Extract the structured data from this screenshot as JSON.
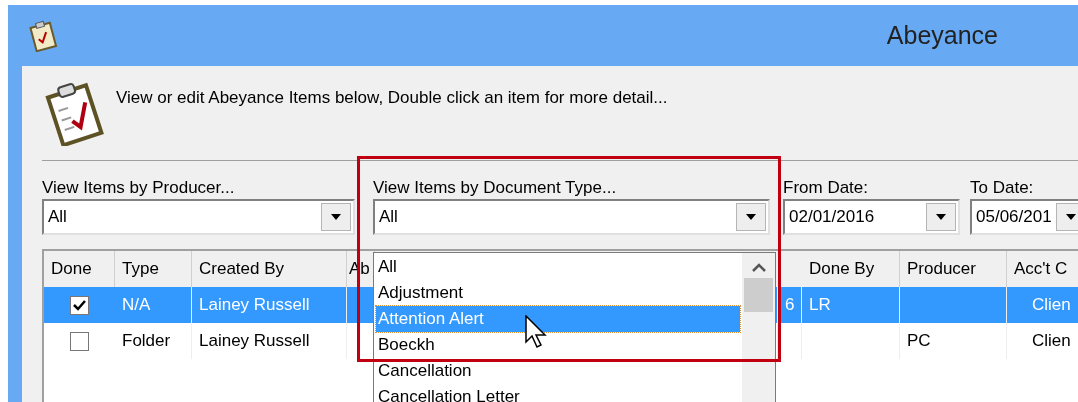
{
  "window": {
    "title": "Abeyance"
  },
  "header": {
    "text": "View or edit Abeyance Items below,  Double click an item for more detail..."
  },
  "filters": [
    {
      "label": "View  Items by Producer...",
      "value": "All"
    },
    {
      "label": "View Items by Document Type...",
      "value": "All"
    },
    {
      "label": "From Date:",
      "value": "02/01/2016"
    },
    {
      "label": "To Date:",
      "value": "05/06/201"
    }
  ],
  "dropdown": {
    "items": [
      {
        "label": "All",
        "selected": false
      },
      {
        "label": "Adjustment",
        "selected": false
      },
      {
        "label": "Attention Alert",
        "selected": true
      },
      {
        "label": "Boeckh",
        "selected": false
      },
      {
        "label": "Cancellation",
        "selected": false
      },
      {
        "label": "Cancellation Letter",
        "selected": false
      }
    ]
  },
  "table": {
    "columns": [
      "Done",
      "Type",
      "Created By",
      "Ab",
      "",
      "Done By",
      "Producer",
      "Acc't C"
    ],
    "rows": [
      {
        "selected": true,
        "done": true,
        "cells": [
          "",
          "N/A",
          "Lainey Russell",
          "",
          "6",
          "LR",
          "",
          "Clien"
        ]
      },
      {
        "selected": false,
        "done": false,
        "cells": [
          "",
          "Folder",
          "Lainey Russell",
          "",
          "",
          "",
          "PC",
          "Clien"
        ]
      }
    ]
  }
}
